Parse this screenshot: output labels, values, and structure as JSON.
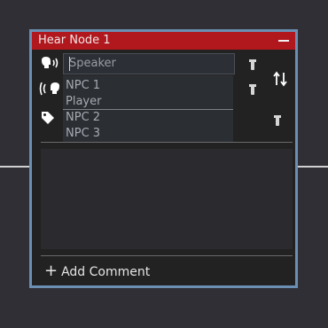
{
  "node": {
    "title": "Hear Node 1",
    "title_color": "#b1181e",
    "border_color": "#6b8fb3"
  },
  "speaker_input": {
    "placeholder": "Speaker",
    "value": ""
  },
  "dropdown": {
    "options": [
      "NPC 1",
      "Player",
      "NPC 2",
      "NPC 3"
    ]
  },
  "icons": {
    "speaker": "speaking-head-icon",
    "listener": "listening-head-icon",
    "tag": "tag-icon",
    "sort": "sort-arrows-icon",
    "pin": "pin-icon",
    "minimize": "minimize-icon",
    "add": "plus-icon"
  },
  "footer": {
    "add_comment_label": "Add Comment"
  }
}
